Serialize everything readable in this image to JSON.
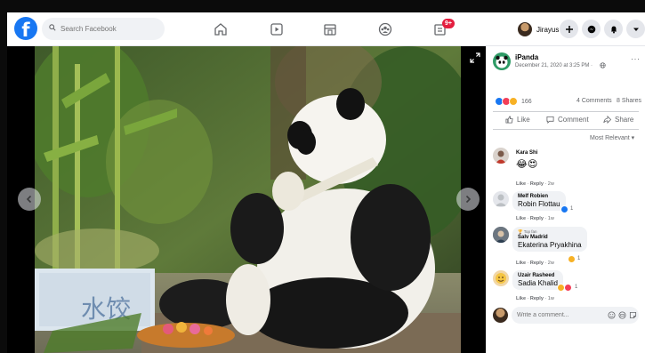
{
  "nav": {
    "logo_letter": "f",
    "search_placeholder": "Search Facebook",
    "notification_badge": "9+",
    "profile_name": "Jirayus"
  },
  "viewer": {
    "sign_text": "水饺"
  },
  "post": {
    "author": "iPanda",
    "date": "December 21, 2020 at 3:25 PM ·",
    "more": "···",
    "reaction_count": "166",
    "comments_count": "4 Comments",
    "shares_count": "8 Shares",
    "actions": {
      "like": "Like",
      "comment": "Comment",
      "share": "Share"
    },
    "sort_label": "Most Relevant ▾"
  },
  "comments": [
    {
      "name": "Kara Shi",
      "text": "😂😍",
      "meta_like": "Like",
      "meta_reply": "Reply",
      "time": "2w",
      "react_count": ""
    },
    {
      "name": "Melf Robien",
      "text": "Robin Flottau",
      "meta_like": "Like",
      "meta_reply": "Reply",
      "time": "1w",
      "react_count": "1"
    },
    {
      "badge": "🏆 Top fan",
      "name": "Salv Madrid",
      "text": "Ekaterina Pryakhina",
      "meta_like": "Like",
      "meta_reply": "Reply",
      "time": "2w",
      "react_count": "1"
    },
    {
      "name": "Uzair Rasheed",
      "text": "Sadia Khalid",
      "meta_like": "Like",
      "meta_reply": "Reply",
      "time": "1w",
      "react_count": "1"
    }
  ],
  "composer": {
    "placeholder": "Write a comment..."
  },
  "colors": {
    "brand": "#1877f2",
    "badge_red": "#e41e3f",
    "panel_bg": "#ffffff",
    "bubble_bg": "#f0f2f5"
  }
}
